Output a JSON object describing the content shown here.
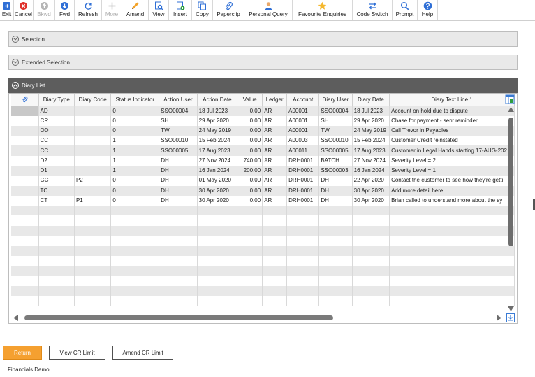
{
  "toolbar": {
    "buttons": [
      {
        "label": "Exit",
        "icon": "exit-icon",
        "enabled": true
      },
      {
        "label": "Cancel",
        "icon": "cancel-icon",
        "enabled": true
      },
      {
        "label": "Bkwd",
        "icon": "backward-icon",
        "enabled": false
      },
      {
        "label": "Fwd",
        "icon": "forward-icon",
        "enabled": true
      },
      {
        "label": "Refresh",
        "icon": "refresh-icon",
        "enabled": true
      },
      {
        "label": "More",
        "icon": "plus-icon",
        "enabled": false
      },
      {
        "label": "Amend",
        "icon": "pencil-icon",
        "enabled": true
      },
      {
        "label": "View",
        "icon": "view-icon",
        "enabled": true
      },
      {
        "label": "Insert",
        "icon": "insert-icon",
        "enabled": true
      },
      {
        "label": "Copy",
        "icon": "copy-icon",
        "enabled": true
      },
      {
        "label": "Paperclip",
        "icon": "paperclip-icon",
        "enabled": true
      },
      {
        "label": "Personal Query",
        "icon": "person-icon",
        "enabled": true
      },
      {
        "label": "Favourite Enquiries",
        "icon": "star-icon",
        "enabled": true
      },
      {
        "label": "Code Switch",
        "icon": "switch-icon",
        "enabled": true
      },
      {
        "label": "Prompt",
        "icon": "magnifier-icon",
        "enabled": true
      },
      {
        "label": "Help",
        "icon": "help-icon",
        "enabled": true
      }
    ]
  },
  "sections": {
    "selection": "Selection",
    "extended_selection": "Extended Selection",
    "diary_list": "Diary List"
  },
  "grid": {
    "columns": [
      "",
      "Diary Type",
      "Diary Code",
      "Status Indicator",
      "Action User",
      "Action Date",
      "Value",
      "Ledger",
      "Account",
      "Diary User",
      "Diary Date",
      "Diary Text Line 1"
    ],
    "rows": [
      [
        "",
        "AD",
        "",
        "0",
        "SSO00004",
        "18 Jul 2023",
        "0.00",
        "AR",
        "A00001",
        "SSO00004",
        "18 Jul 2023",
        "Account on hold due to dispute"
      ],
      [
        "",
        "CR",
        "",
        "0",
        "SH",
        "29 Apr 2020",
        "0.00",
        "AR",
        "A00001",
        "SH",
        "29 Apr 2020",
        "Chase for payment - sent reminder"
      ],
      [
        "",
        "OD",
        "",
        "0",
        "TW",
        "24 May 2019",
        "0.00",
        "AR",
        "A00001",
        "TW",
        "24 May 2019",
        "Call Trevor in Payables"
      ],
      [
        "",
        "CC",
        "",
        "1",
        "SSO00010",
        "15 Feb 2024",
        "0.00",
        "AR",
        "A00003",
        "SSO00010",
        "15 Feb 2024",
        "Customer Credit reinstated"
      ],
      [
        "",
        "CC",
        "",
        "1",
        "SSO00005",
        "17 Aug 2023",
        "0.00",
        "AR",
        "A00011",
        "SSO00005",
        "17 Aug 2023",
        "Customer in Legal Hands starting 17-AUG-202"
      ],
      [
        "",
        "D2",
        "",
        "1",
        "DH",
        "27 Nov 2024",
        "740.00",
        "AR",
        "DRH0001",
        "BATCH",
        "27 Nov 2024",
        "Severity Level   = 2"
      ],
      [
        "",
        "D1",
        "",
        "1",
        "DH",
        "16 Jan 2024",
        "200.00",
        "AR",
        "DRH0001",
        "SSO00003",
        "16 Jan 2024",
        "Severity Level   = 1"
      ],
      [
        "",
        "GC",
        "P2",
        "0",
        "DH",
        "01 May 2020",
        "0.00",
        "AR",
        "DRH0001",
        "DH",
        "22 Apr 2020",
        "Contact the customer to see how they're getti"
      ],
      [
        "",
        "TC",
        "",
        "0",
        "DH",
        "30 Apr 2020",
        "0.00",
        "AR",
        "DRH0001",
        "DH",
        "30 Apr 2020",
        "Add more detail here....."
      ],
      [
        "",
        "CT",
        "P1",
        "0",
        "DH",
        "30 Apr 2020",
        "0.00",
        "AR",
        "DRH0001",
        "DH",
        "30 Apr 2020",
        "Brian called to understand more about the sy"
      ]
    ]
  },
  "buttons": {
    "return": "Return",
    "view_cr_limit": "View CR Limit",
    "amend_cr_limit": "Amend CR Limit"
  },
  "footer": "Financials Demo",
  "colors": {
    "accent": "#f5a030",
    "section_dark": "#5d5d5d",
    "row_alt": "#e8e8e8"
  }
}
